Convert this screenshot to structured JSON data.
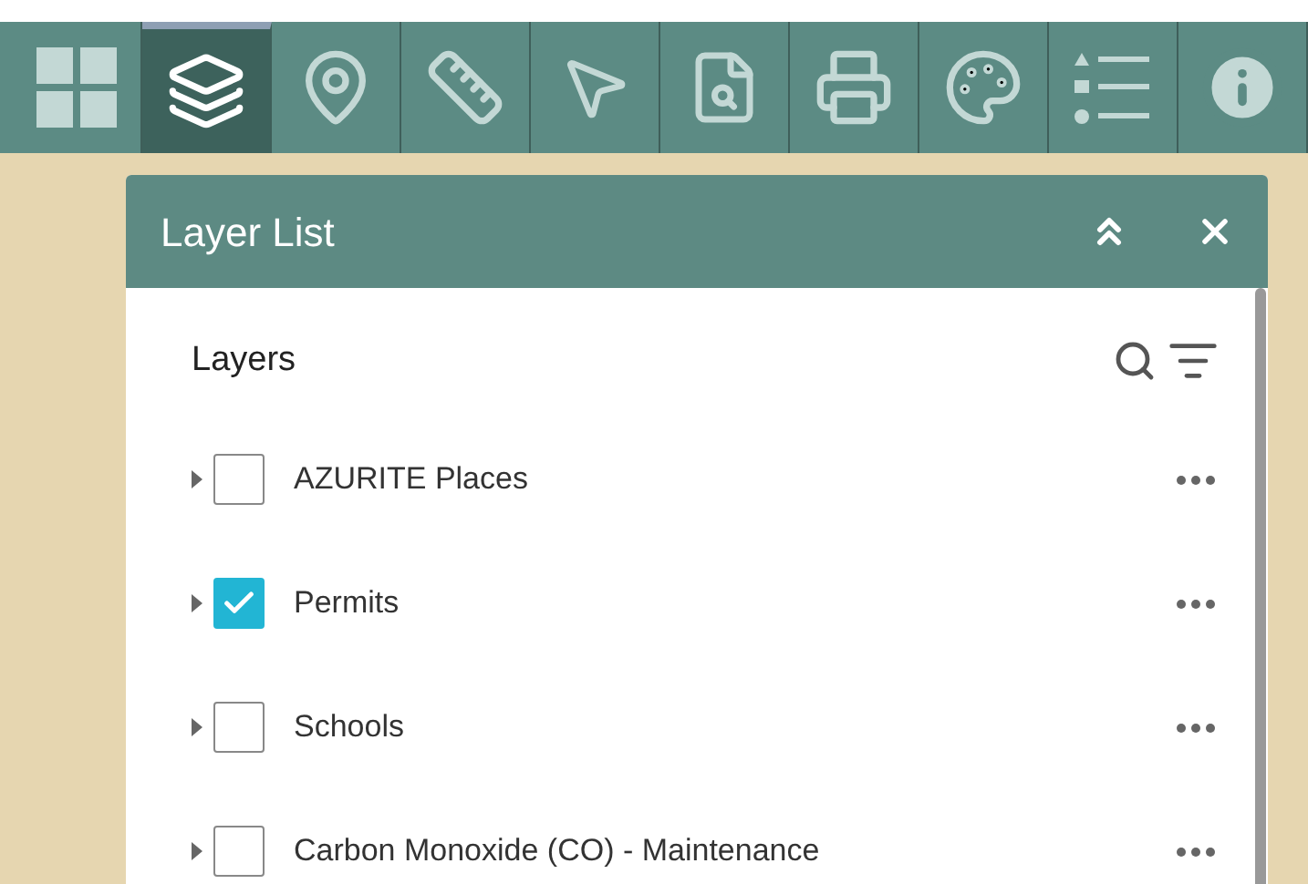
{
  "toolbar": [
    {
      "selected": false
    },
    {
      "selected": true
    },
    {
      "selected": false
    },
    {
      "selected": false
    },
    {
      "selected": false
    },
    {
      "selected": false
    },
    {
      "selected": false
    },
    {
      "selected": false
    },
    {
      "selected": false
    },
    {
      "selected": false
    }
  ],
  "panel": {
    "title": "Layer List",
    "section_label": "Layers",
    "layers": [
      {
        "name": "AZURITE Places",
        "checked": false
      },
      {
        "name": "Permits",
        "checked": true
      },
      {
        "name": "Schools",
        "checked": false
      },
      {
        "name": "Carbon Monoxide (CO) - Maintenance",
        "checked": false
      }
    ]
  }
}
